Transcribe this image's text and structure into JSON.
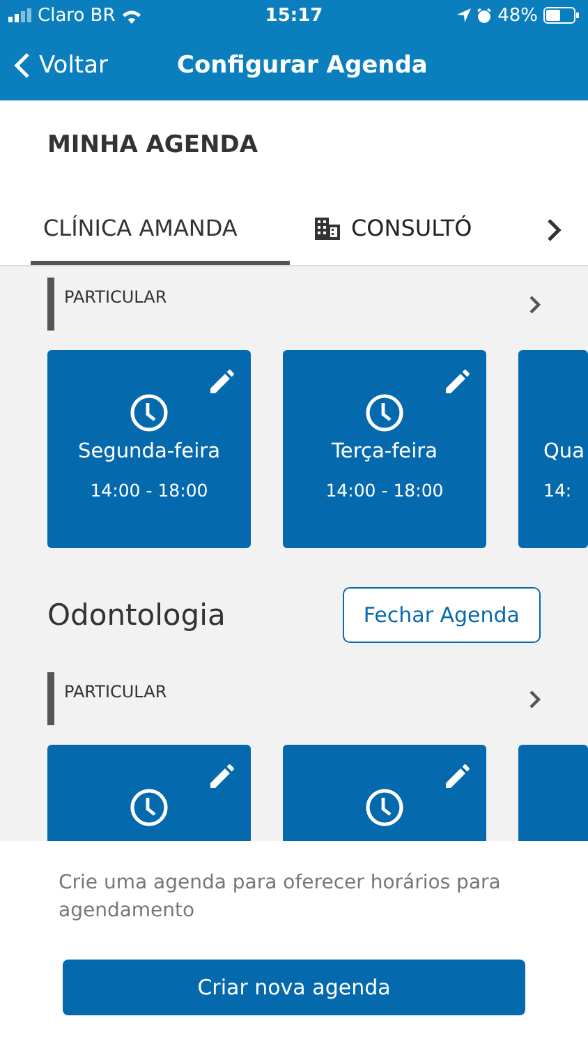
{
  "status_bar": {
    "carrier": "Claro BR",
    "time": "15:17",
    "battery": "48%"
  },
  "nav": {
    "back": "Voltar",
    "title": "Configurar Agenda"
  },
  "heading": "MINHA AGENDA",
  "tabs": [
    {
      "label": "CLÍNICA AMANDA",
      "selected": true,
      "kind": "plain"
    },
    {
      "label": "CONSULTÓ",
      "selected": false,
      "kind": "building"
    }
  ],
  "blocks": [
    {
      "kind": "agenda",
      "category": "PARTICULAR",
      "cards": [
        {
          "kind": "schedule",
          "day": "Segunda-feira",
          "hours": "14:00 - 18:00"
        },
        {
          "kind": "schedule",
          "day": "Terça-feira",
          "hours": "14:00 - 18:00"
        },
        {
          "kind": "schedule",
          "day": "Qua",
          "hours": "14:"
        }
      ]
    },
    {
      "kind": "specialty",
      "title": "Odontologia",
      "button": "Fechar Agenda"
    },
    {
      "kind": "agenda",
      "category": "PARTICULAR",
      "cards": [
        {
          "kind": "schedule"
        },
        {
          "kind": "schedule"
        },
        {
          "kind": "schedule"
        }
      ]
    }
  ],
  "sheet": {
    "message": "Crie uma agenda para oferecer horários para agendamento",
    "button": "Criar nova agenda"
  }
}
